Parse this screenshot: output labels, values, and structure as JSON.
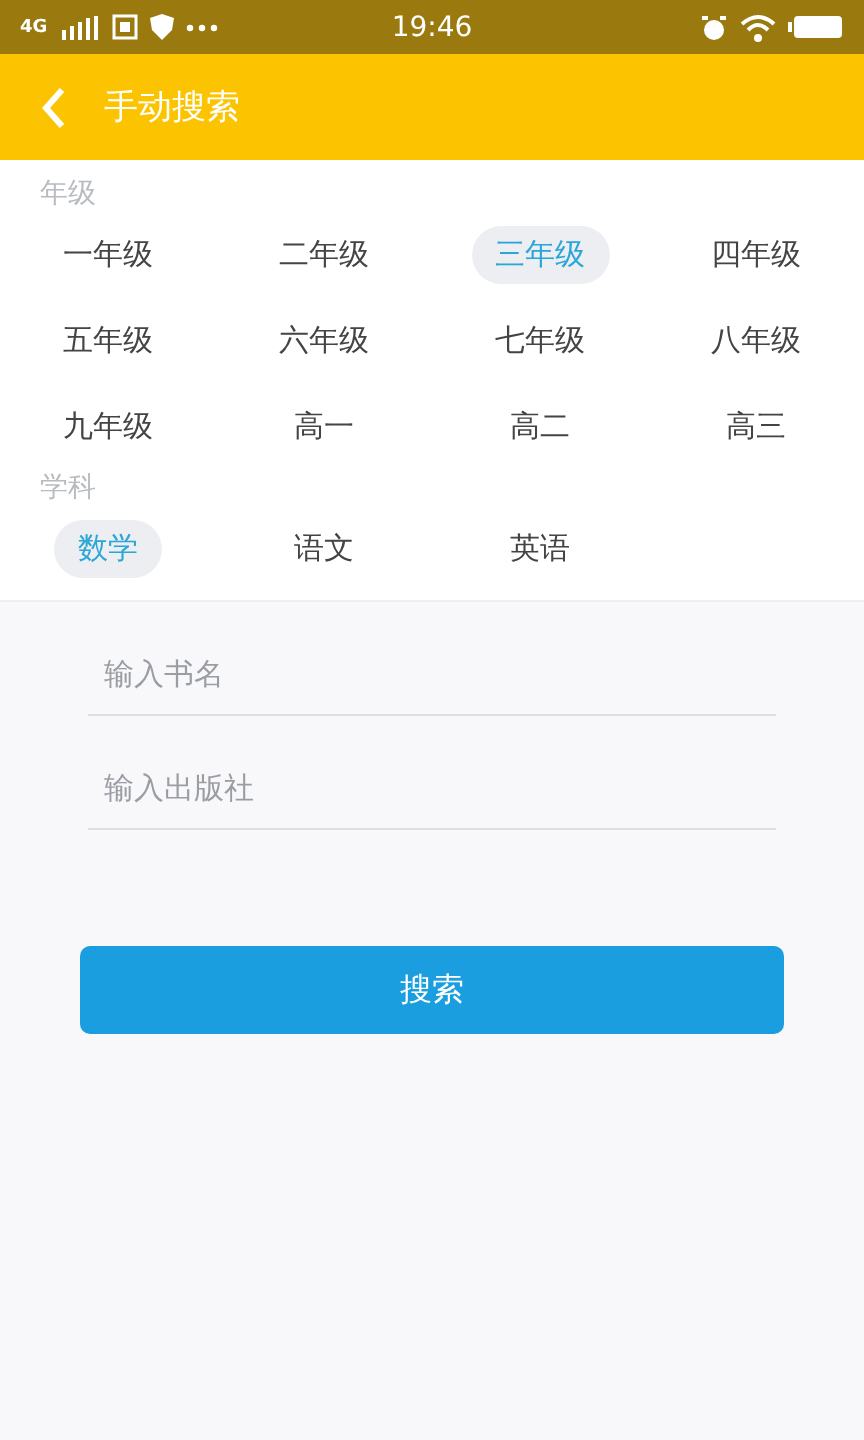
{
  "status_bar": {
    "network": "4G",
    "time": "19:46"
  },
  "header": {
    "title": "手动搜索"
  },
  "grade": {
    "label": "年级",
    "options": [
      {
        "label": "一年级",
        "selected": false
      },
      {
        "label": "二年级",
        "selected": false
      },
      {
        "label": "三年级",
        "selected": true
      },
      {
        "label": "四年级",
        "selected": false
      },
      {
        "label": "五年级",
        "selected": false
      },
      {
        "label": "六年级",
        "selected": false
      },
      {
        "label": "七年级",
        "selected": false
      },
      {
        "label": "八年级",
        "selected": false
      },
      {
        "label": "九年级",
        "selected": false
      },
      {
        "label": "高一",
        "selected": false
      },
      {
        "label": "高二",
        "selected": false
      },
      {
        "label": "高三",
        "selected": false
      }
    ]
  },
  "subject": {
    "label": "学科",
    "options": [
      {
        "label": "数学",
        "selected": true
      },
      {
        "label": "语文",
        "selected": false
      },
      {
        "label": "英语",
        "selected": false
      }
    ]
  },
  "fields": [
    {
      "placeholder": "输入书名"
    },
    {
      "placeholder": "输入出版社"
    }
  ],
  "search_button": "搜索"
}
